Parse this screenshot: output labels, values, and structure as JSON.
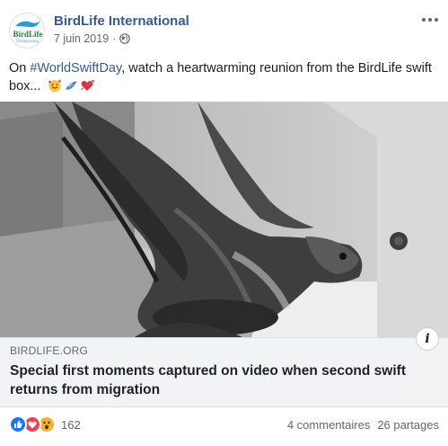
{
  "post": {
    "page_name": "BirdLife International",
    "avatar_text": "BirdLife",
    "avatar_subtext": "INTERNATIONAL",
    "date": "7 juin 2019",
    "dot": "·",
    "visibility_icon": "globe-icon",
    "more_icon": "more-options-icon",
    "message": {
      "prefix": "On ",
      "hashtag": "#WorldSwiftDay",
      "suffix": ", watch a heartwarming reunion from the BirdLife swift box...",
      "emojis": [
        "smiling-face-with-hearts-emoji",
        "bird-emoji",
        "heart-with-arrow-emoji"
      ]
    }
  },
  "link_preview": {
    "domain": "BIRDLIFE.ORG",
    "title": "Special first moments captured on video when second swift returns from migration",
    "info_label": "i"
  },
  "footer": {
    "reaction_icons": [
      "like-reaction-icon",
      "love-reaction-icon",
      "wow-reaction-icon"
    ],
    "reaction_count": "162",
    "comments": "4 commentaires",
    "shares": "26 partages"
  },
  "colors": {
    "link_blue": "#365899",
    "like_blue": "#1877f2",
    "love_red": "#f33e58",
    "wow_yellow": "#f7b125",
    "link_box_bg": "#f2f3f5"
  }
}
